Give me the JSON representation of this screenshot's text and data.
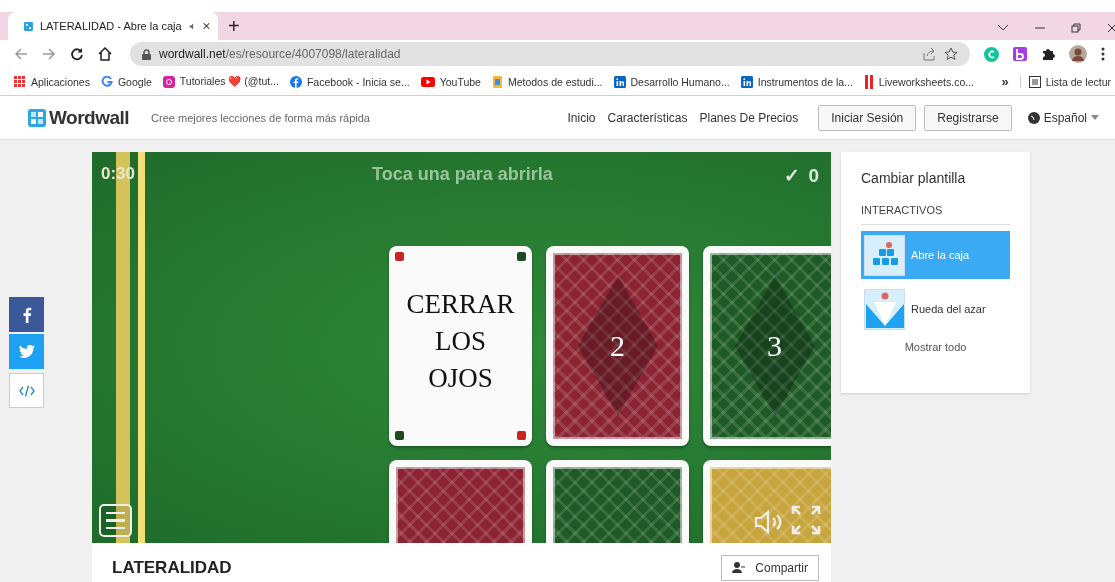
{
  "browser": {
    "tab": {
      "title": "LATERALIDAD - Abre la caja",
      "audio": true
    },
    "new_tab": "+",
    "address": {
      "host": "wordwall.net",
      "path": "/es/resource/4007098/lateralidad"
    },
    "bookmarks": [
      {
        "label": "Aplicaciones",
        "kind": "apps"
      },
      {
        "label": "Google",
        "kind": "google"
      },
      {
        "label": "Tutoriales ❤️ (@tut...",
        "kind": "instagram"
      },
      {
        "label": "Facebook - Inicia se...",
        "kind": "facebook"
      },
      {
        "label": "YouTube",
        "kind": "youtube"
      },
      {
        "label": "Metodos de estudi...",
        "kind": "page"
      },
      {
        "label": "Desarrollo Humano...",
        "kind": "linkedin"
      },
      {
        "label": "Instrumentos de la...",
        "kind": "linkedin"
      },
      {
        "label": "Liveworksheets.co...",
        "kind": "bars"
      }
    ],
    "more": "»",
    "reading_list": "Lista de lectur"
  },
  "site": {
    "logo": "Wordwall",
    "tagline": "Cree mejores lecciones de forma más rápida",
    "nav": [
      "Inicio",
      "Características",
      "Planes De Precios"
    ],
    "buttons": [
      "Iniciar Sesión",
      "Registrarse"
    ],
    "language": "Español"
  },
  "game": {
    "timer": "0:30",
    "prompt": "Toca una para abrirla",
    "check": "✓",
    "score": "0",
    "cards": [
      {
        "kind": "face",
        "text": "CERRAR LOS OJOS"
      },
      {
        "kind": "back",
        "color": "#8b2332",
        "number": "2"
      },
      {
        "kind": "back",
        "color": "#1e5a25",
        "number": "3"
      },
      {
        "kind": "back",
        "color": "#8b2332"
      },
      {
        "kind": "back",
        "color": "#1e5a25"
      },
      {
        "kind": "back",
        "color": "#c8a43c"
      }
    ]
  },
  "activity": {
    "title": "LATERALIDAD",
    "share": "Compartir"
  },
  "templates": {
    "title": "Cambiar plantilla",
    "section": "INTERACTIVOS",
    "items": [
      {
        "label": "Abre la caja",
        "kind": "boxes",
        "selected": true
      },
      {
        "label": "Rueda del azar",
        "kind": "wheel",
        "selected": false
      }
    ],
    "show_all": "Mostrar todo"
  }
}
